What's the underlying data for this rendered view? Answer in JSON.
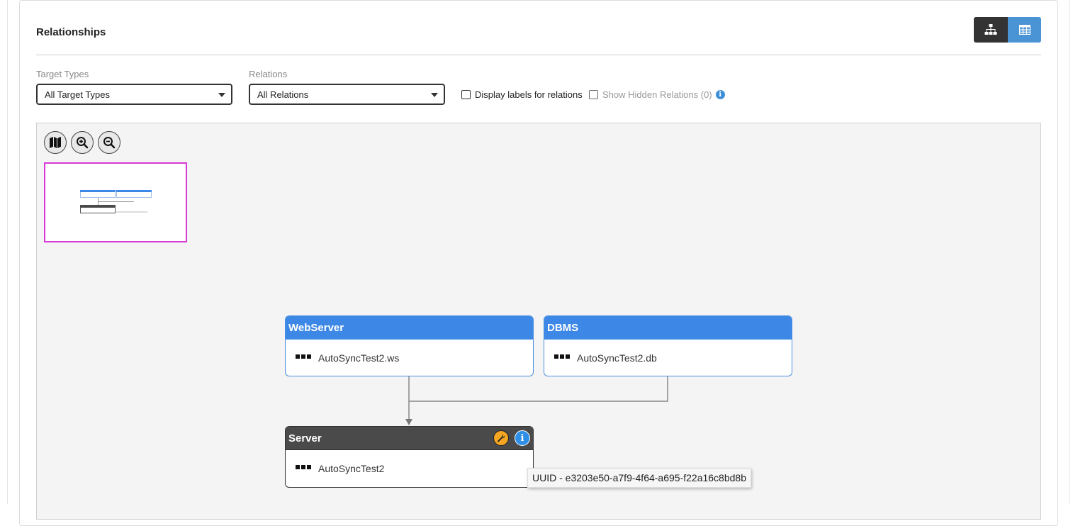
{
  "panel": {
    "title": "Relationships"
  },
  "view_toggle": {
    "hierarchy_icon": "sitemap-icon",
    "table_icon": "table-icon",
    "active": "hierarchy"
  },
  "filters": {
    "target_types": {
      "label": "Target Types",
      "value": "All Target Types"
    },
    "relations": {
      "label": "Relations",
      "value": "All Relations"
    },
    "display_labels": {
      "label": "Display labels for relations",
      "checked": false
    },
    "show_hidden": {
      "label": "Show Hidden Relations (0)",
      "checked": false,
      "icon": "info-icon"
    }
  },
  "toolbar": {
    "map_icon": "map-icon",
    "zoom_in_icon": "zoom-in-icon",
    "zoom_out_icon": "zoom-out-icon"
  },
  "nodes": [
    {
      "id": "webserver",
      "type": "WebServer",
      "name": "AutoSyncTest2.ws"
    },
    {
      "id": "dbms",
      "type": "DBMS",
      "name": "AutoSyncTest2.db"
    },
    {
      "id": "server",
      "type": "Server",
      "name": "AutoSyncTest2",
      "icons": [
        "wrench-icon",
        "info-icon"
      ]
    }
  ],
  "tooltip": {
    "text": "UUID - e3203e50-a7f9-4f64-a695-f22a16c8bd8b"
  },
  "colors": {
    "node_blue": "#3d87e6",
    "node_dark": "#4a4a4a",
    "toggle_active": "#333333",
    "toggle_inactive": "#4a93d4",
    "minimap_border": "#d63ad6"
  }
}
